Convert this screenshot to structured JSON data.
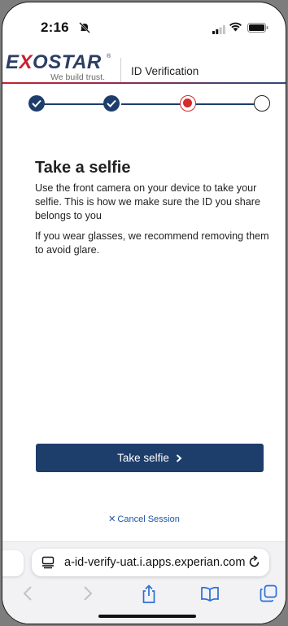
{
  "status_bar": {
    "time": "2:16"
  },
  "header": {
    "logo_text": "EXOSTAR",
    "logo_tagline": "We build trust.",
    "title": "ID Verification"
  },
  "progress": {
    "steps": [
      {
        "state": "completed"
      },
      {
        "state": "completed"
      },
      {
        "state": "current"
      },
      {
        "state": "pending"
      }
    ]
  },
  "main": {
    "heading": "Take a selfie",
    "paragraph1": "Use the front camera on your device to take your selfie. This is how we make sure the ID you share belongs to you",
    "paragraph2": "If you wear glasses, we recommend removing them to avoid glare.",
    "primary_button": "Take selfie",
    "cancel_link": "Cancel Session"
  },
  "browser": {
    "address": "a-id-verify-uat.i.apps.experian.com"
  },
  "colors": {
    "navy": "#1d3d6b",
    "brand_red": "#c8202e",
    "link_blue": "#1d56a6"
  }
}
